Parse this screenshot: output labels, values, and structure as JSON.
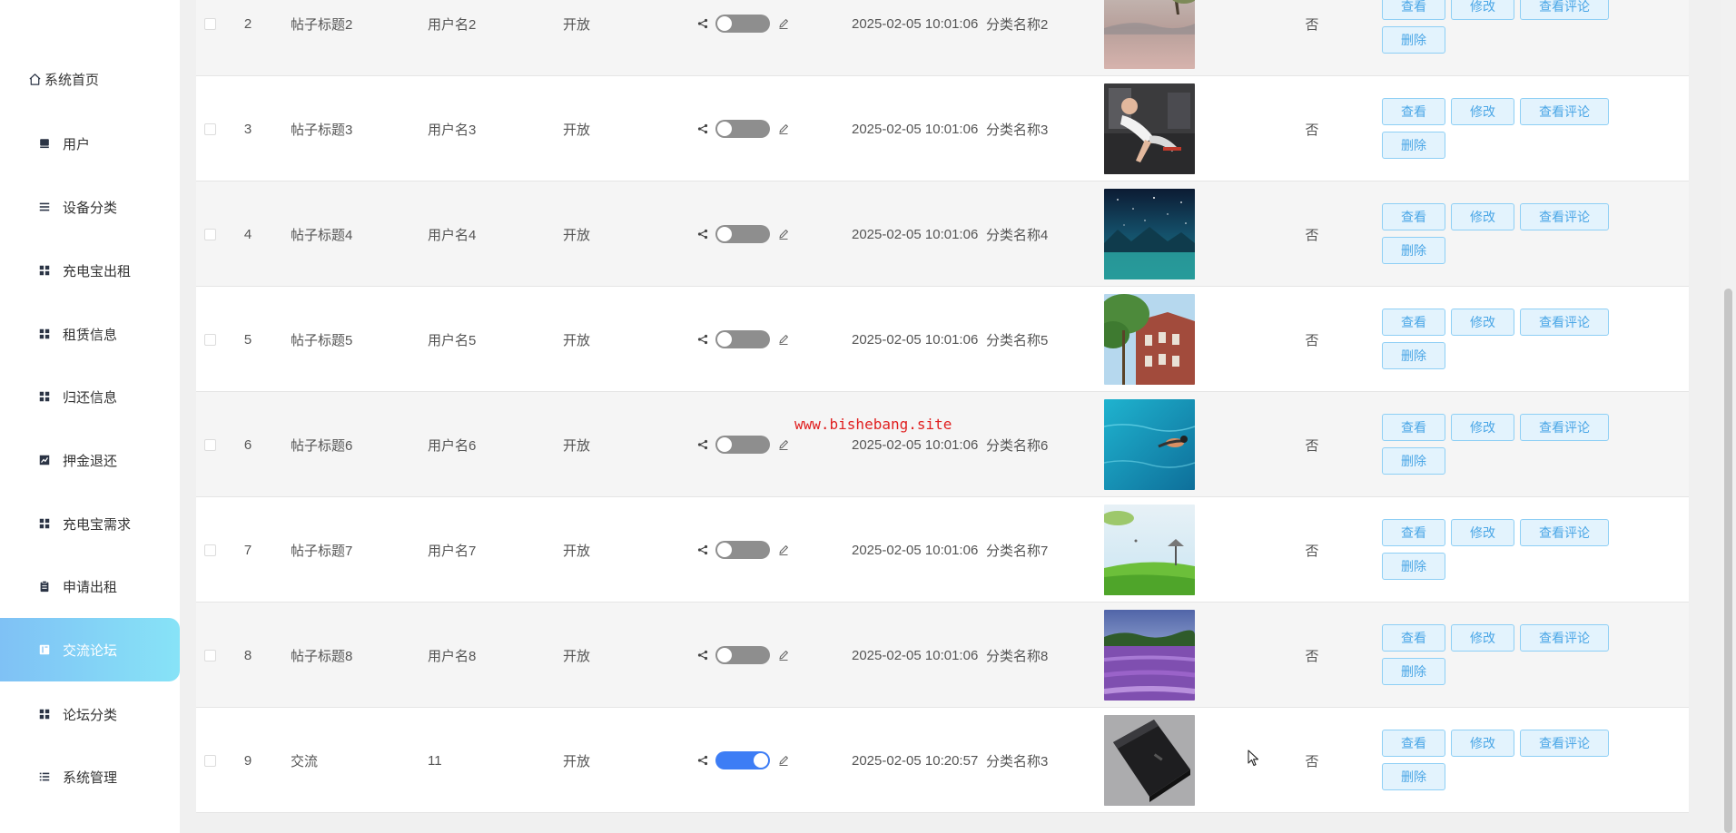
{
  "sidebar": {
    "items": [
      {
        "label": "系统首页",
        "icon": "home-icon",
        "active": false,
        "key": "home"
      },
      {
        "label": "用户",
        "icon": "user-book-icon",
        "active": false,
        "key": "user"
      },
      {
        "label": "设备分类",
        "icon": "list-icon",
        "active": false,
        "key": "device-category"
      },
      {
        "label": "充电宝出租",
        "icon": "grid-icon",
        "active": false,
        "key": "powerbank-rent"
      },
      {
        "label": "租赁信息",
        "icon": "grid-icon",
        "active": false,
        "key": "lease-info"
      },
      {
        "label": "归还信息",
        "icon": "grid-icon",
        "active": false,
        "key": "return-info"
      },
      {
        "label": "押金退还",
        "icon": "chart-icon",
        "active": false,
        "key": "deposit-refund"
      },
      {
        "label": "充电宝需求",
        "icon": "grid-icon",
        "active": false,
        "key": "powerbank-demand"
      },
      {
        "label": "申请出租",
        "icon": "clipboard-icon",
        "active": false,
        "key": "apply-rent"
      },
      {
        "label": "交流论坛",
        "icon": "book-icon",
        "active": true,
        "key": "forum"
      },
      {
        "label": "论坛分类",
        "icon": "grid-icon",
        "active": false,
        "key": "forum-category"
      },
      {
        "label": "系统管理",
        "icon": "settings-list-icon",
        "active": false,
        "key": "system-admin"
      }
    ]
  },
  "table": {
    "actions": {
      "view": "查看",
      "edit": "修改",
      "comments": "查看评论",
      "delete": "删除"
    },
    "rows": [
      {
        "index": "2",
        "title": "帖子标题2",
        "user": "用户名2",
        "status": "开放",
        "switch_on": false,
        "time": "2025-02-05 10:01:06",
        "category": "分类名称2",
        "image": "misty-lake-tree",
        "flag": "否"
      },
      {
        "index": "3",
        "title": "帖子标题3",
        "user": "用户名3",
        "status": "开放",
        "switch_on": false,
        "time": "2025-02-05 10:01:06",
        "category": "分类名称3",
        "image": "gym-woman",
        "flag": "否"
      },
      {
        "index": "4",
        "title": "帖子标题4",
        "user": "用户名4",
        "status": "开放",
        "switch_on": false,
        "time": "2025-02-05 10:01:06",
        "category": "分类名称4",
        "image": "starry-sky-lake",
        "flag": "否"
      },
      {
        "index": "5",
        "title": "帖子标题5",
        "user": "用户名5",
        "status": "开放",
        "switch_on": false,
        "time": "2025-02-05 10:01:06",
        "category": "分类名称5",
        "image": "brick-building",
        "flag": "否"
      },
      {
        "index": "6",
        "title": "帖子标题6",
        "user": "用户名6",
        "status": "开放",
        "switch_on": false,
        "time": "2025-02-05 10:01:06",
        "category": "分类名称6",
        "image": "swimmer-pool",
        "flag": "否"
      },
      {
        "index": "7",
        "title": "帖子标题7",
        "user": "用户名7",
        "status": "开放",
        "switch_on": false,
        "time": "2025-02-05 10:01:06",
        "category": "分类名称7",
        "image": "green-meadow",
        "flag": "否"
      },
      {
        "index": "8",
        "title": "帖子标题8",
        "user": "用户名8",
        "status": "开放",
        "switch_on": false,
        "time": "2025-02-05 10:01:06",
        "category": "分类名称8",
        "image": "lavender-field",
        "flag": "否"
      },
      {
        "index": "9",
        "title": "交流",
        "user": "11",
        "status": "开放",
        "switch_on": true,
        "time": "2025-02-05 10:20:57",
        "category": "分类名称3",
        "image": "power-bank",
        "flag": "否"
      }
    ]
  },
  "watermark": "www.bishebang.site",
  "colors": {
    "active_menu_start": "#7fc1f5",
    "active_menu_end": "#87e3f7",
    "switch_on": "#3d7df5",
    "switch_off": "#8e8e8e",
    "button_border": "#8ecff5",
    "button_bg": "#e3f3fd",
    "button_text": "#4aa6e6",
    "watermark": "#e01f1f"
  }
}
